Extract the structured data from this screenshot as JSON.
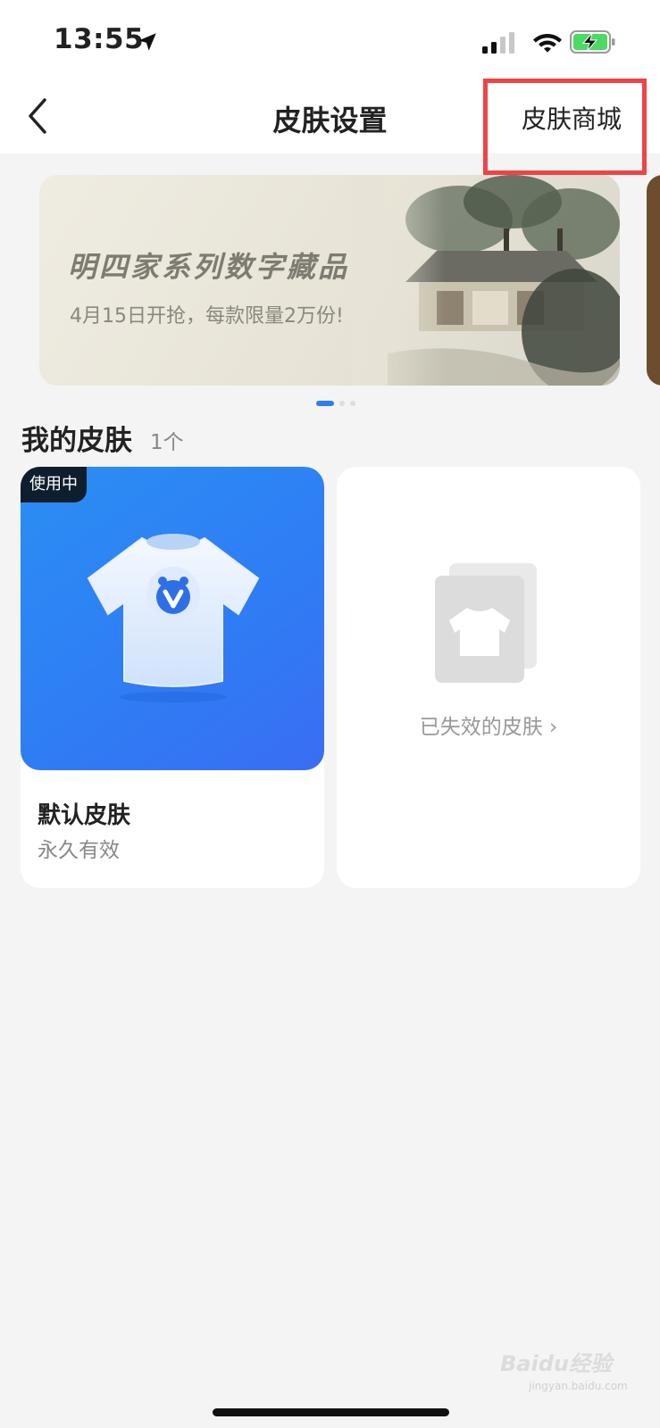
{
  "status_bar": {
    "time": "13:55",
    "battery_color": "#4cd964"
  },
  "nav": {
    "back_icon": "chevron-left-icon",
    "title": "皮肤设置",
    "action_label": "皮肤商城",
    "highlight_color": "#ef4444"
  },
  "banner": {
    "title": "明四家系列数字藏品",
    "subtitle": "4月15日开抢，每款限量2万份!",
    "page_count": 3,
    "active_page": 1,
    "indicator_color": "#2f7cf4"
  },
  "my_skins": {
    "title": "我的皮肤",
    "count": "1个",
    "items": [
      {
        "badge": "使用中",
        "name": "默认皮肤",
        "validity": "永久有效",
        "icon": "tshirt-icon",
        "color": "#2f7cf4"
      }
    ],
    "expired": {
      "label": "已失效的皮肤 ›",
      "icon": "stacked-tshirt-icon"
    }
  },
  "watermark": {
    "text": "Baidu经验",
    "sub": "jingyan.baidu.com"
  }
}
